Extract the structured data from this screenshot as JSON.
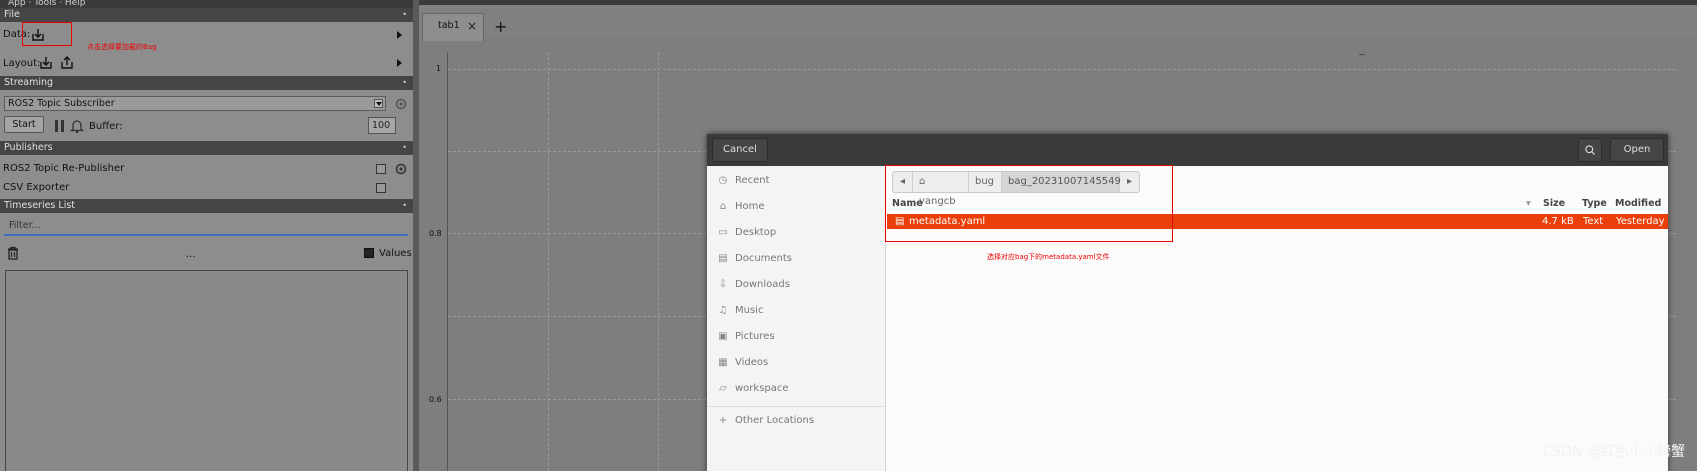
{
  "menubar": {
    "text": "App  ·  Tools  ·  Help"
  },
  "sections": {
    "file": "File",
    "streaming": "Streaming",
    "publishers": "Publishers",
    "timeseries": "Timeseries List"
  },
  "file": {
    "data_label": "Data:",
    "layout_label": "Layout:",
    "annotation": "点击选择要加载的Bag"
  },
  "streaming": {
    "selected_plugin": "ROS2 Topic Subscriber",
    "start_label": "Start",
    "buffer_label": "Buffer:",
    "buffer_value": "100"
  },
  "publishers": {
    "items": [
      "ROS2 Topic Re-Publisher",
      "CSV Exporter"
    ]
  },
  "timeseries": {
    "filter_placeholder": "Filter...",
    "dots": "...",
    "values_label": "Values"
  },
  "plot": {
    "tab_label": "tab1",
    "yticks": [
      "1",
      "0.8",
      "0.6"
    ],
    "top_marker": "--"
  },
  "dialog": {
    "cancel_label": "Cancel",
    "open_label": "Open",
    "places": [
      {
        "label": "Recent",
        "icon": "clock-icon"
      },
      {
        "label": "Home",
        "icon": "home-icon"
      },
      {
        "label": "Desktop",
        "icon": "desktop-icon"
      },
      {
        "label": "Documents",
        "icon": "document-icon"
      },
      {
        "label": "Downloads",
        "icon": "download-icon"
      },
      {
        "label": "Music",
        "icon": "music-icon"
      },
      {
        "label": "Pictures",
        "icon": "picture-icon"
      },
      {
        "label": "Videos",
        "icon": "video-icon"
      },
      {
        "label": "workspace",
        "icon": "folder-icon"
      }
    ],
    "other_locations": "Other Locations",
    "breadcrumb": [
      "yangcb",
      "bug",
      "bag_20231007145549"
    ],
    "columns": {
      "name": "Name",
      "size": "Size",
      "type": "Type",
      "modified": "Modified"
    },
    "file": {
      "name": "metadata.yaml",
      "size": "4.7 kB",
      "type": "Text",
      "modified": "Yesterday"
    },
    "annotation": "选择对应bag下的metadata.yaml文件"
  },
  "watermark": "CSDN @红色小小螃蟹",
  "colors": {
    "accent": "#ea3f0a",
    "annotation": "#e00000"
  }
}
